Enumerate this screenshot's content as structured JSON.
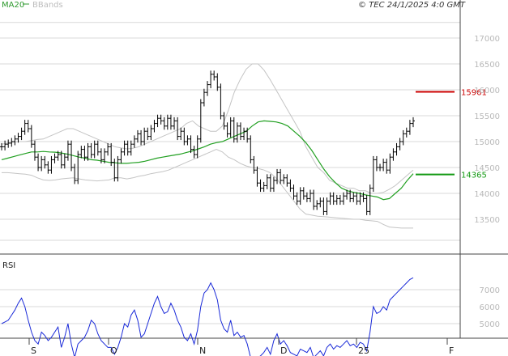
{
  "header": {
    "legend_ma": "MA20",
    "legend_bb": "BBands",
    "copyright": "© TEC 24/1/2025 4:0 GMT"
  },
  "colors": {
    "ma": "#22a022",
    "bbands": "#c4c4c4",
    "price": "#000000",
    "rsi": "#1a2ad8",
    "resistance": "#cc0000",
    "support": "#119911",
    "grid": "#d9d9d9"
  },
  "chart_data": [
    {
      "type": "ohlc",
      "title": "",
      "y_ticks": [
        13500,
        14000,
        14500,
        15000,
        15500,
        16000,
        16500,
        17000
      ],
      "y_tick_labels": [
        "13500",
        "14000",
        "14500",
        "15000",
        "15500",
        "16000",
        "16500",
        "17000"
      ],
      "ylim": [
        12900,
        17300
      ],
      "grid": true,
      "x_categories": [
        "S",
        "O",
        "N",
        "D",
        "25",
        "F"
      ],
      "levels": [
        {
          "name": "resistance",
          "value": 15961,
          "label": "15961"
        },
        {
          "name": "support",
          "value": 14365,
          "label": "14365"
        }
      ],
      "series": [
        {
          "name": "price",
          "values": [
            14900,
            14950,
            14970,
            15000,
            15050,
            15100,
            15200,
            15350,
            15250,
            14950,
            14700,
            14500,
            14650,
            14550,
            14450,
            14650,
            14700,
            14750,
            14550,
            14700,
            14950,
            14500,
            14250,
            14750,
            14850,
            14700,
            14900,
            14750,
            14950,
            14800,
            14650,
            14800,
            14900,
            14600,
            14300,
            14650,
            14800,
            14950,
            14800,
            14950,
            15050,
            15150,
            15000,
            15200,
            15100,
            15250,
            15350,
            15450,
            15400,
            15300,
            15450,
            15300,
            15400,
            15100,
            15200,
            15000,
            15050,
            14850,
            14750,
            15050,
            15750,
            15950,
            16100,
            16300,
            16250,
            16050,
            15500,
            15300,
            15150,
            15400,
            15050,
            15300,
            15100,
            15200,
            15050,
            14650,
            14450,
            14200,
            14100,
            14150,
            14300,
            14100,
            14250,
            14400,
            14250,
            14300,
            14200,
            14100,
            13950,
            13850,
            14050,
            13950,
            13900,
            14000,
            13750,
            13800,
            13850,
            13650,
            13850,
            13950,
            13850,
            13900,
            13850,
            13950,
            14000,
            13900,
            13950,
            13850,
            13950,
            13900,
            13650,
            14100,
            14650,
            14500,
            14500,
            14600,
            14450,
            14700,
            14800,
            14900,
            15000,
            15150,
            15200,
            15350,
            15400
          ]
        },
        {
          "name": "MA20",
          "values": [
            14650,
            14680,
            14710,
            14740,
            14770,
            14800,
            14800,
            14810,
            14800,
            14795,
            14780,
            14760,
            14730,
            14700,
            14680,
            14650,
            14640,
            14620,
            14600,
            14590,
            14580,
            14580,
            14590,
            14600,
            14620,
            14650,
            14680,
            14700,
            14720,
            14740,
            14760,
            14790,
            14820,
            14860,
            14900,
            14950,
            14980,
            15000,
            15050,
            15100,
            15150,
            15200,
            15300,
            15380,
            15400,
            15390,
            15380,
            15350,
            15300,
            15200,
            15100,
            14980,
            14830,
            14650,
            14470,
            14320,
            14200,
            14100,
            14050,
            14020,
            14000,
            13970,
            13950,
            13930,
            13880,
            13900,
            14000,
            14100,
            14250,
            14380
          ]
        },
        {
          "name": "BBand upper",
          "values": [
            14950,
            14970,
            14990,
            15000,
            15000,
            15020,
            15040,
            15050,
            15100,
            15150,
            15200,
            15250,
            15250,
            15200,
            15150,
            15100,
            15050,
            15000,
            14950,
            14900,
            14880,
            14860,
            14870,
            14900,
            14950,
            15000,
            15050,
            15100,
            15150,
            15200,
            15250,
            15350,
            15400,
            15300,
            15250,
            15200,
            15200,
            15300,
            15600,
            15950,
            16200,
            16400,
            16500,
            16500,
            16380,
            16200,
            16000,
            15800,
            15600,
            15400,
            15200,
            14900,
            14700,
            14500,
            14400,
            14250,
            14200,
            14150,
            14100,
            14100,
            14050,
            14050,
            14000,
            14000,
            14020,
            14080,
            14150,
            14250,
            14350,
            14450
          ]
        },
        {
          "name": "BBand lower",
          "values": [
            14400,
            14400,
            14390,
            14380,
            14370,
            14350,
            14300,
            14260,
            14250,
            14260,
            14280,
            14290,
            14300,
            14280,
            14260,
            14250,
            14240,
            14250,
            14260,
            14300,
            14300,
            14280,
            14300,
            14330,
            14350,
            14380,
            14400,
            14420,
            14450,
            14500,
            14550,
            14600,
            14650,
            14700,
            14750,
            14800,
            14850,
            14800,
            14700,
            14650,
            14580,
            14530,
            14500,
            14480,
            14450,
            14400,
            14300,
            14150,
            14000,
            13850,
            13700,
            13600,
            13580,
            13560,
            13550,
            13540,
            13530,
            13520,
            13510,
            13500,
            13500,
            13480,
            13470,
            13460,
            13400,
            13350,
            13340,
            13330,
            13330,
            13330
          ]
        }
      ]
    },
    {
      "type": "line",
      "title": "RSI",
      "y_ticks": [
        50,
        60,
        70
      ],
      "y_tick_labels": [
        "5000",
        "6000",
        "7000"
      ],
      "ylim": [
        20,
        85
      ],
      "series": [
        {
          "name": "RSI",
          "values": [
            50,
            51,
            52,
            55,
            58,
            62,
            65,
            60,
            52,
            45,
            40,
            38,
            45,
            43,
            40,
            42,
            45,
            48,
            36,
            42,
            50,
            38,
            30,
            38,
            40,
            42,
            46,
            52,
            50,
            44,
            40,
            38,
            36,
            36,
            32,
            36,
            42,
            50,
            48,
            55,
            58,
            52,
            42,
            44,
            50,
            56,
            62,
            66,
            60,
            56,
            57,
            62,
            58,
            52,
            48,
            42,
            40,
            44,
            38,
            46,
            60,
            68,
            70,
            74,
            70,
            64,
            52,
            47,
            45,
            52,
            43,
            45,
            42,
            43,
            38,
            30,
            28,
            30,
            31,
            33,
            36,
            32,
            40,
            44,
            38,
            40,
            37,
            33,
            32,
            31,
            35,
            34,
            33,
            36,
            30,
            32,
            34,
            31,
            36,
            38,
            35,
            37,
            36,
            38,
            40,
            37,
            38,
            36,
            39,
            38,
            34,
            45,
            60,
            56,
            57,
            60,
            58,
            64,
            66,
            68,
            70,
            72,
            74,
            76,
            77
          ]
        }
      ]
    }
  ]
}
